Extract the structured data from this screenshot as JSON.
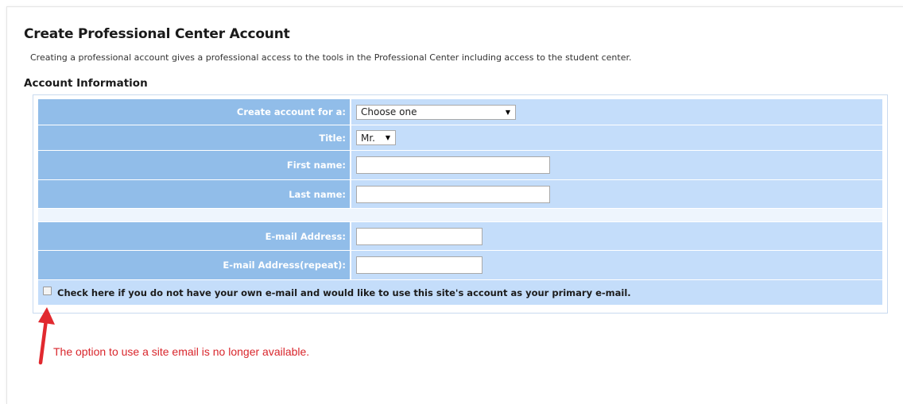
{
  "page": {
    "title": "Create Professional Center Account",
    "intro": "Creating a professional account gives a professional access to the tools in the Professional Center including access to the student center.",
    "section_title": "Account Information"
  },
  "form": {
    "account_for_label": "Create account for a:",
    "account_for_value": "Choose one",
    "title_label": "Title:",
    "title_value": "Mr.",
    "first_name_label": "First name:",
    "first_name_value": "",
    "last_name_label": "Last name:",
    "last_name_value": "",
    "email_label": "E-mail Address:",
    "email_value": "",
    "email_repeat_label": "E-mail Address(repeat):",
    "email_repeat_value": "",
    "site_email_checkbox_label": "Check here if you do not have your own e-mail and would like to use this site's account as your primary e-mail.",
    "site_email_checked": false
  },
  "annotation": {
    "notice": "The option to use a site email is no longer available.",
    "color": "#d9262c"
  },
  "colors": {
    "label_bg": "#91bde9",
    "value_bg": "#c4ddfa"
  }
}
